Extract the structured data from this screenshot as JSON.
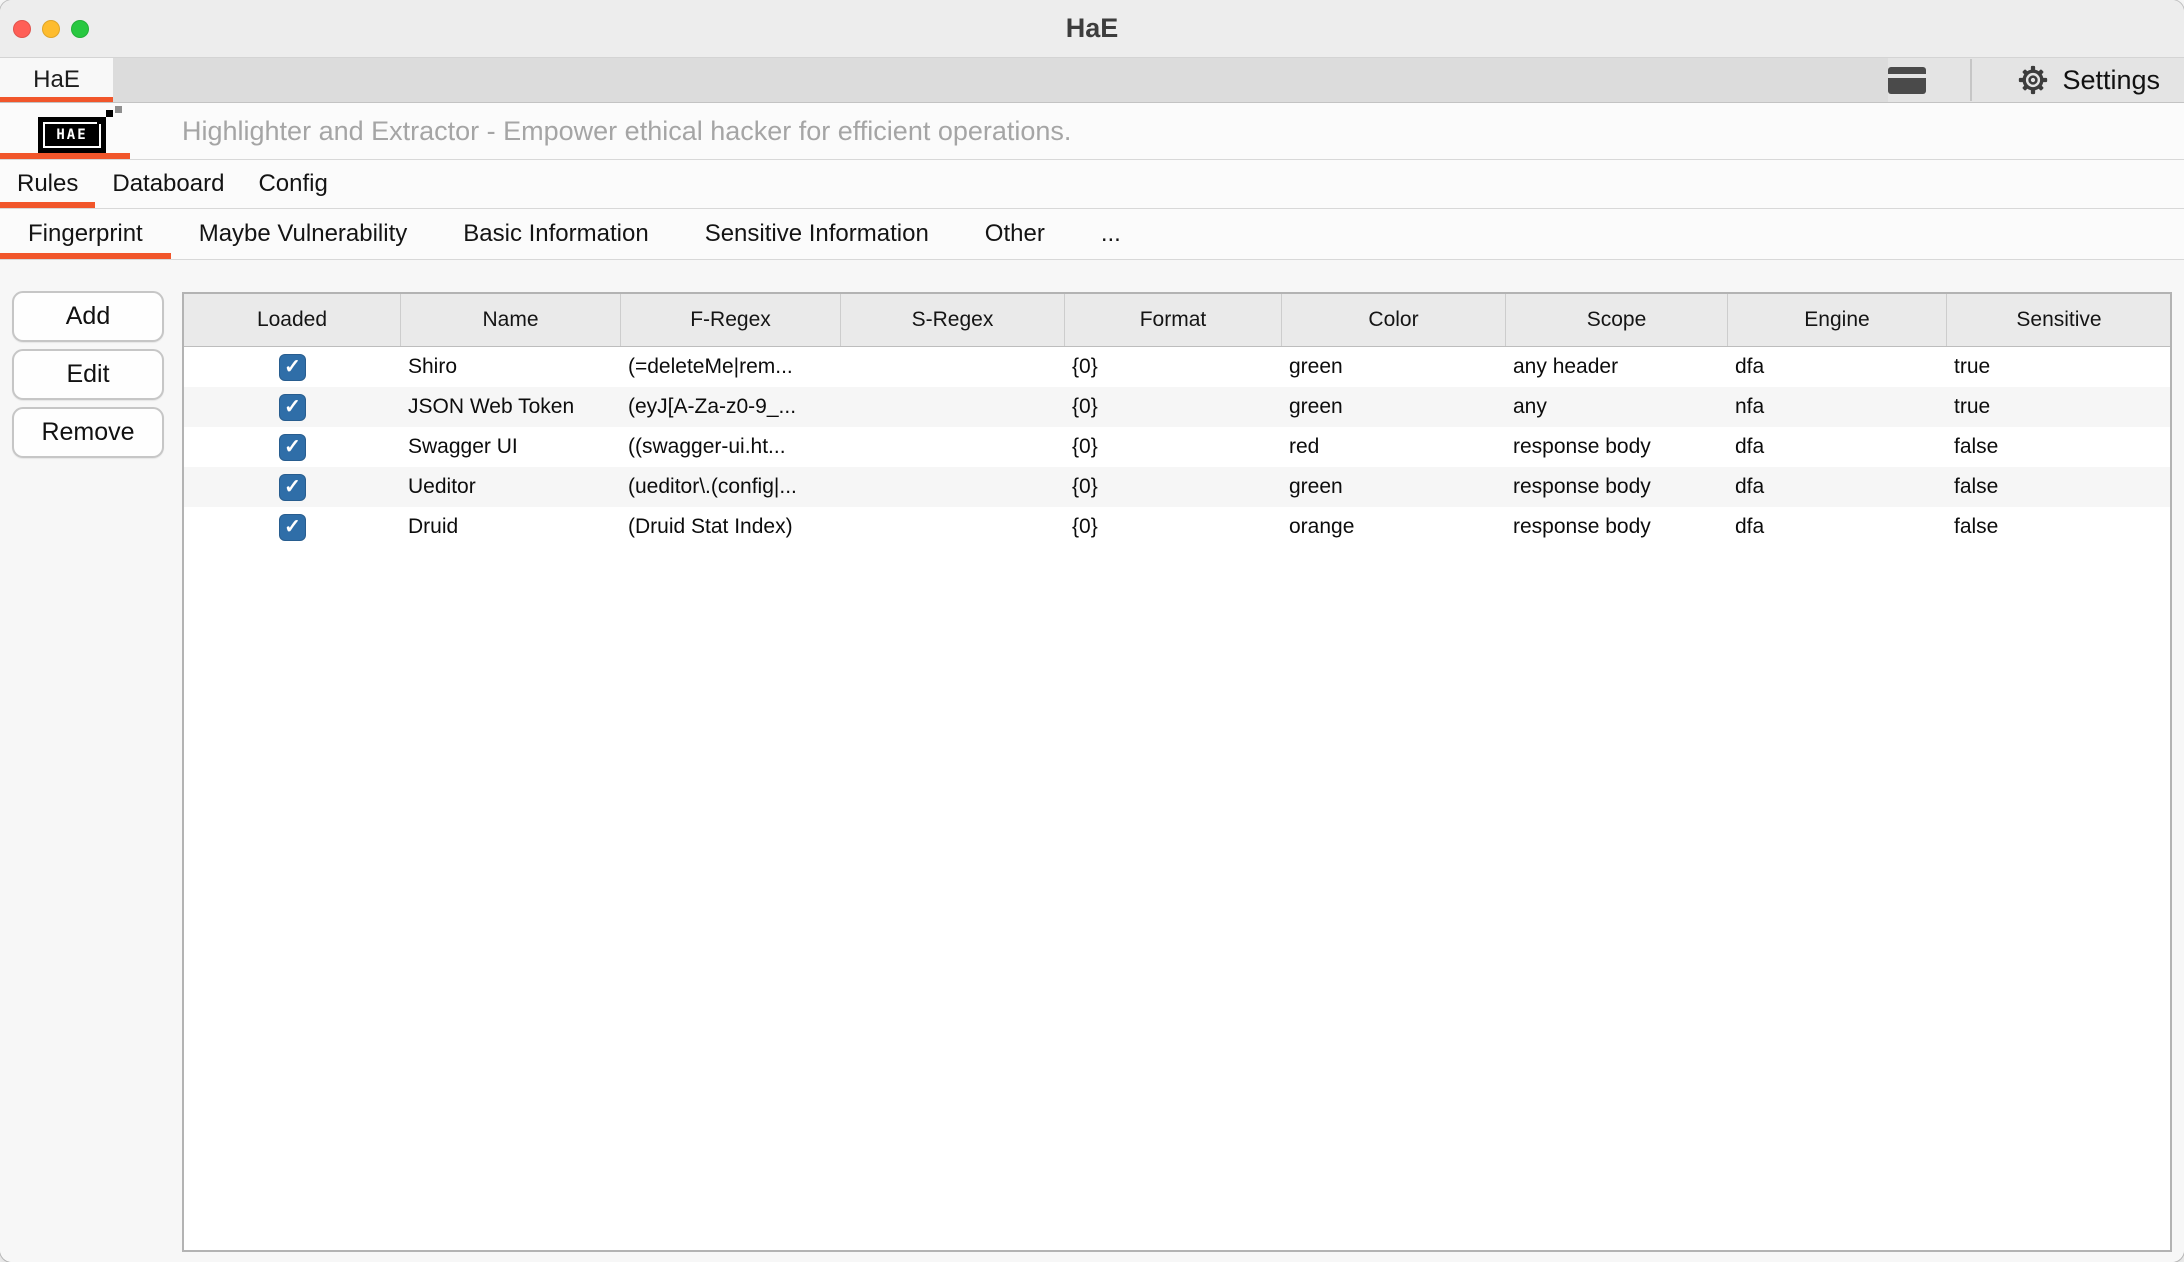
{
  "window": {
    "title": "HaE"
  },
  "colors": {
    "accent": "#f1562b",
    "checkbox_blue": "#2f6ea8",
    "traffic_close": "#ff5f57",
    "traffic_minimize": "#febc2e",
    "traffic_zoom": "#28c840"
  },
  "icons": {
    "check": "✓"
  },
  "top_bar": {
    "tab": "HaE",
    "settings_label": "Settings"
  },
  "banner": {
    "logo_text": "HAE",
    "subtitle": "Highlighter and Extractor - Empower ethical hacker for efficient operations."
  },
  "main_tabs": {
    "selected": 0,
    "items": [
      "Rules",
      "Databoard",
      "Config"
    ]
  },
  "sub_tabs": {
    "selected": 0,
    "items": [
      "Fingerprint",
      "Maybe Vulnerability",
      "Basic Information",
      "Sensitive Information",
      "Other",
      "..."
    ]
  },
  "actions": {
    "buttons": [
      "Add",
      "Edit",
      "Remove"
    ]
  },
  "table": {
    "columns": [
      {
        "key": "loaded",
        "label": "Loaded"
      },
      {
        "key": "name",
        "label": "Name"
      },
      {
        "key": "f_regex",
        "label": "F-Regex"
      },
      {
        "key": "s_regex",
        "label": "S-Regex"
      },
      {
        "key": "format",
        "label": "Format"
      },
      {
        "key": "color",
        "label": "Color"
      },
      {
        "key": "scope",
        "label": "Scope"
      },
      {
        "key": "engine",
        "label": "Engine"
      },
      {
        "key": "sensitive",
        "label": "Sensitive"
      }
    ],
    "rows": [
      {
        "loaded": true,
        "name": "Shiro",
        "f_regex": "(=deleteMe|rem...",
        "s_regex": "",
        "format": "{0}",
        "color": "green",
        "scope": "any header",
        "engine": "dfa",
        "sensitive": "true"
      },
      {
        "loaded": true,
        "name": "JSON Web Token",
        "f_regex": "(eyJ[A-Za-z0-9_...",
        "s_regex": "",
        "format": "{0}",
        "color": "green",
        "scope": "any",
        "engine": "nfa",
        "sensitive": "true"
      },
      {
        "loaded": true,
        "name": "Swagger UI",
        "f_regex": "((swagger-ui.ht...",
        "s_regex": "",
        "format": "{0}",
        "color": "red",
        "scope": "response body",
        "engine": "dfa",
        "sensitive": "false"
      },
      {
        "loaded": true,
        "name": "Ueditor",
        "f_regex": "(ueditor\\.(config|...",
        "s_regex": "",
        "format": "{0}",
        "color": "green",
        "scope": "response body",
        "engine": "dfa",
        "sensitive": "false"
      },
      {
        "loaded": true,
        "name": "Druid",
        "f_regex": "(Druid Stat Index)",
        "s_regex": "",
        "format": "{0}",
        "color": "orange",
        "scope": "response body",
        "engine": "dfa",
        "sensitive": "false"
      }
    ]
  }
}
